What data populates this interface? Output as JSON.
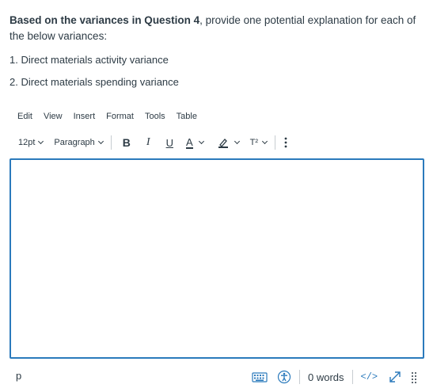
{
  "question": {
    "bold_text": "Based on the variances in Question 4",
    "rest_text": ", provide one potential explanation for each of the below variances:",
    "items": [
      "1. Direct materials activity variance",
      "2. Direct materials spending variance"
    ]
  },
  "menubar": {
    "edit": "Edit",
    "view": "View",
    "insert": "Insert",
    "format": "Format",
    "tools": "Tools",
    "table": "Table"
  },
  "toolbar": {
    "font_size": "12pt",
    "block_format": "Paragraph",
    "bold": "B",
    "italic": "I",
    "underline": "U",
    "text_color": "A",
    "superscript": "T²",
    "text_color_hex": "#2d3b45",
    "highlight_color_hex": "#2d3b45",
    "more_icon": "vertical-ellipsis-icon"
  },
  "editor": {
    "content": ""
  },
  "statusbar": {
    "path": "p",
    "word_count": "0 words",
    "html_editor": "</>",
    "accent_color": "#2b7abc"
  }
}
